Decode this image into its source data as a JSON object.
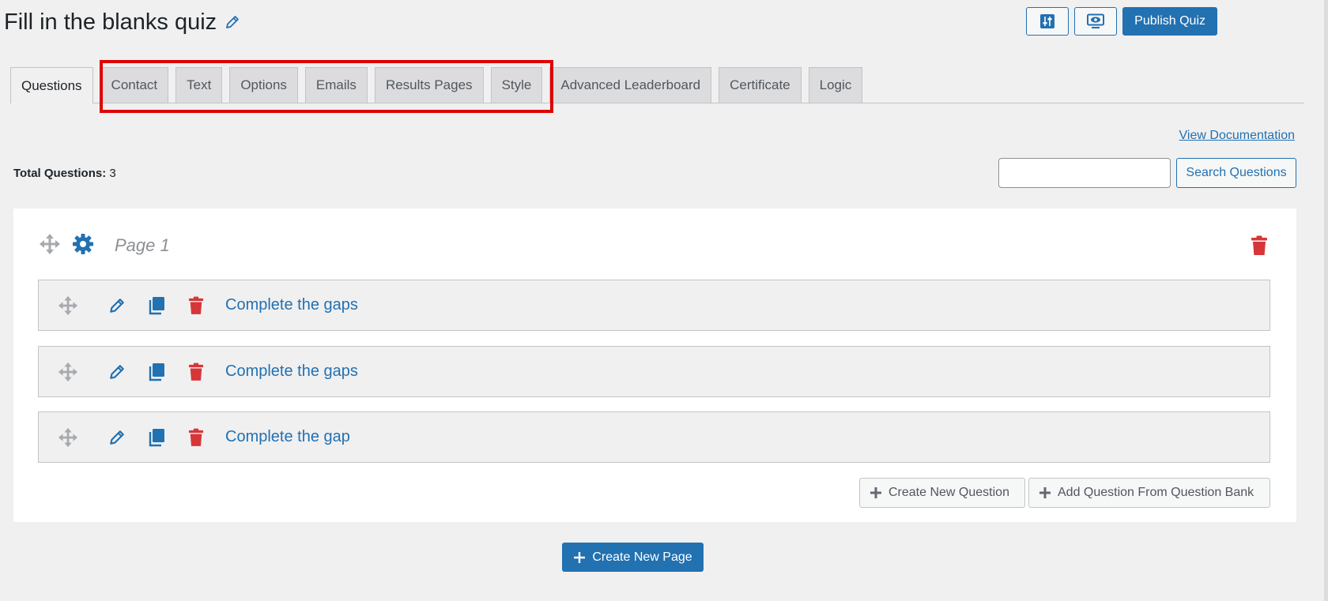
{
  "header": {
    "title": "Fill in the blanks quiz",
    "publish_label": "Publish Quiz"
  },
  "tabs": [
    {
      "label": "Questions",
      "active": true
    },
    {
      "label": "Contact"
    },
    {
      "label": "Text"
    },
    {
      "label": "Options"
    },
    {
      "label": "Emails"
    },
    {
      "label": "Results Pages"
    },
    {
      "label": "Style"
    },
    {
      "label": "Advanced Leaderboard"
    },
    {
      "label": "Certificate"
    },
    {
      "label": "Logic"
    }
  ],
  "toolbar": {
    "view_documentation": "View Documentation",
    "total_label": "Total Questions:",
    "total_value": "3",
    "search_value": "",
    "search_button": "Search Questions"
  },
  "page": {
    "title": "Page 1",
    "questions": [
      {
        "title": "Complete the gaps"
      },
      {
        "title": "Complete the gaps"
      },
      {
        "title": "Complete the gap"
      }
    ],
    "create_question_label": "Create New Question",
    "add_from_bank_label": "Add Question From Question Bank"
  },
  "footer": {
    "create_page_label": "Create New Page"
  },
  "colors": {
    "accent": "#2271b1",
    "danger": "#d63638",
    "highlight": "#e00000",
    "background": "#f0f0f1"
  },
  "icons": {
    "title_edit": "pencil-icon",
    "top_action_1": "settings-sliders-icon",
    "top_action_2": "preview-screen-icon",
    "move": "move-arrows-icon",
    "settings": "gear-icon",
    "edit": "pencil-icon",
    "duplicate": "copy-icon",
    "delete": "trash-icon",
    "add": "plus-icon"
  }
}
